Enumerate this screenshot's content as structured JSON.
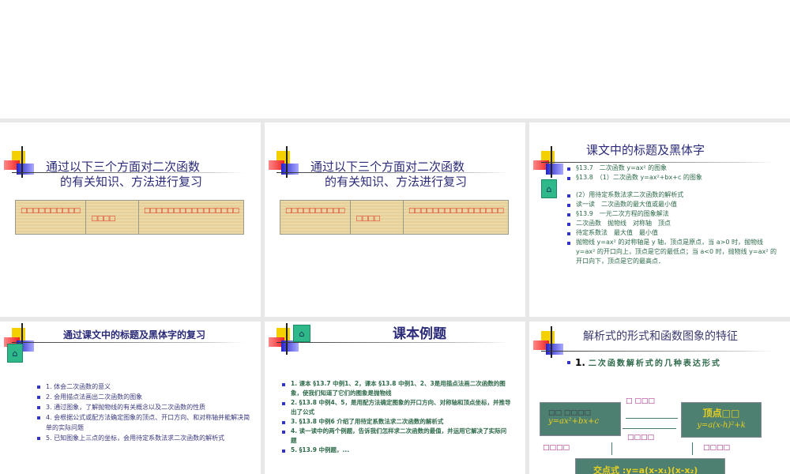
{
  "slides": [
    {
      "title_line1": "通过以下三个方面对二次函数",
      "title_line2": "的有关知识、方法进行复习",
      "table": [
        "□□□□□□□□□□",
        "□□□□",
        "□□□□□□□□□□□□□□□□"
      ]
    },
    {
      "title_line1": "通过以下三个方面对二次函数",
      "title_line2": "的有关知识、方法进行复习",
      "table": [
        "□□□□□□□□□□",
        "□□□□",
        "□□□□□□□□□□□□□□□□"
      ]
    },
    {
      "title": "课文中的标题及黑体字",
      "items": [
        "§13.7　二次函数 y=ax² 的图象",
        "§13.8　（1）二次函数 y=ax²+bx+c 的图象",
        "(2）用待定系数法求二次函数的解析式",
        "读一读　二次函数的最大值或最小值",
        "§13.9　一元二次方程的图象解法",
        "二次函数　抛物线　对称轴　顶点",
        "待定系数法　最大值　最小值",
        "抛物线 y=ax² 的对称轴是 y 轴，顶点是原点，当 a>0 时，抛物线 y=ax² 的开口向上，顶点是它的最低点；当 a<0 时，抛物线 y=ax² 的开口向下，顶点是它的最高点．"
      ]
    },
    {
      "title": "通过课文中的标题及黑体字的复习",
      "items": [
        "1. 体会二次函数的意义",
        "2. 会用描点法画出二次函数的图象",
        "3. 通过图象，了解抛物线的有关概念以及二次函数的性质",
        "4. 会根据公式或配方法确定图象的顶点、开口方向、和对称轴并能解决简单的实际问题",
        "5. 已知图象上三点的坐标，会用待定系数法求二次函数的解析式"
      ]
    },
    {
      "title": "课本例题",
      "items": [
        "1. 课本 §13.7 中例1、2，课本 §13.8 中例1、2、3是用描点法画二次函数的图象，使我们知道了它们的图象是抛物线",
        "2. §13.8 中例4、5，是用配方法确定图象的开口方向、对称轴和顶点坐标，并推导出了公式",
        "3. §13.8 中例6 介绍了用待定系数法求二次函数的解析式",
        "4. 读一读中的两个例题，告诉我们怎样求二次函数的最值，并运用它解决了实际问题",
        "5. §13.9 中例题，..."
      ]
    },
    {
      "title": "解析式的形式和函数图象的特征",
      "item_num": "1.",
      "item": "二次函数解析式的几种表达形式",
      "general_prefix": "□□ □□□□",
      "general_formula": "y=ax²+bx+c",
      "vertex_label": "顶点□□",
      "vertex_formula": "y=a(x-h)²+k",
      "intercept": "交点式 :y=a(x-x₁)(x-x₂)",
      "label_top": "□ □□□",
      "label_mid": "□□□□",
      "label_left": "□□□□",
      "label_right": "□□□□"
    }
  ]
}
